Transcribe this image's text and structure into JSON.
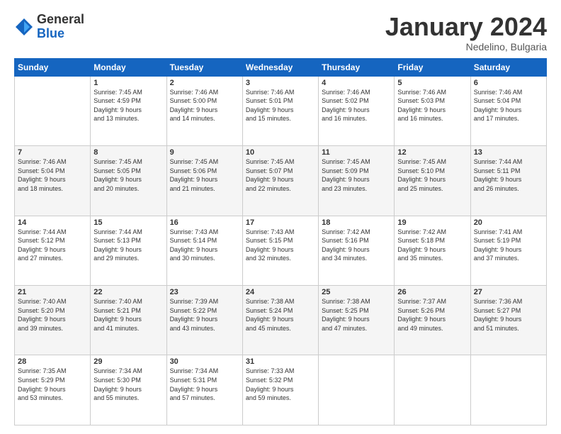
{
  "logo": {
    "general": "General",
    "blue": "Blue"
  },
  "title": "January 2024",
  "location": "Nedelino, Bulgaria",
  "days_of_week": [
    "Sunday",
    "Monday",
    "Tuesday",
    "Wednesday",
    "Thursday",
    "Friday",
    "Saturday"
  ],
  "weeks": [
    [
      {
        "day": "",
        "info": ""
      },
      {
        "day": "1",
        "info": "Sunrise: 7:45 AM\nSunset: 4:59 PM\nDaylight: 9 hours\nand 13 minutes."
      },
      {
        "day": "2",
        "info": "Sunrise: 7:46 AM\nSunset: 5:00 PM\nDaylight: 9 hours\nand 14 minutes."
      },
      {
        "day": "3",
        "info": "Sunrise: 7:46 AM\nSunset: 5:01 PM\nDaylight: 9 hours\nand 15 minutes."
      },
      {
        "day": "4",
        "info": "Sunrise: 7:46 AM\nSunset: 5:02 PM\nDaylight: 9 hours\nand 16 minutes."
      },
      {
        "day": "5",
        "info": "Sunrise: 7:46 AM\nSunset: 5:03 PM\nDaylight: 9 hours\nand 16 minutes."
      },
      {
        "day": "6",
        "info": "Sunrise: 7:46 AM\nSunset: 5:04 PM\nDaylight: 9 hours\nand 17 minutes."
      }
    ],
    [
      {
        "day": "7",
        "info": "Sunrise: 7:46 AM\nSunset: 5:04 PM\nDaylight: 9 hours\nand 18 minutes."
      },
      {
        "day": "8",
        "info": "Sunrise: 7:45 AM\nSunset: 5:05 PM\nDaylight: 9 hours\nand 20 minutes."
      },
      {
        "day": "9",
        "info": "Sunrise: 7:45 AM\nSunset: 5:06 PM\nDaylight: 9 hours\nand 21 minutes."
      },
      {
        "day": "10",
        "info": "Sunrise: 7:45 AM\nSunset: 5:07 PM\nDaylight: 9 hours\nand 22 minutes."
      },
      {
        "day": "11",
        "info": "Sunrise: 7:45 AM\nSunset: 5:09 PM\nDaylight: 9 hours\nand 23 minutes."
      },
      {
        "day": "12",
        "info": "Sunrise: 7:45 AM\nSunset: 5:10 PM\nDaylight: 9 hours\nand 25 minutes."
      },
      {
        "day": "13",
        "info": "Sunrise: 7:44 AM\nSunset: 5:11 PM\nDaylight: 9 hours\nand 26 minutes."
      }
    ],
    [
      {
        "day": "14",
        "info": "Sunrise: 7:44 AM\nSunset: 5:12 PM\nDaylight: 9 hours\nand 27 minutes."
      },
      {
        "day": "15",
        "info": "Sunrise: 7:44 AM\nSunset: 5:13 PM\nDaylight: 9 hours\nand 29 minutes."
      },
      {
        "day": "16",
        "info": "Sunrise: 7:43 AM\nSunset: 5:14 PM\nDaylight: 9 hours\nand 30 minutes."
      },
      {
        "day": "17",
        "info": "Sunrise: 7:43 AM\nSunset: 5:15 PM\nDaylight: 9 hours\nand 32 minutes."
      },
      {
        "day": "18",
        "info": "Sunrise: 7:42 AM\nSunset: 5:16 PM\nDaylight: 9 hours\nand 34 minutes."
      },
      {
        "day": "19",
        "info": "Sunrise: 7:42 AM\nSunset: 5:18 PM\nDaylight: 9 hours\nand 35 minutes."
      },
      {
        "day": "20",
        "info": "Sunrise: 7:41 AM\nSunset: 5:19 PM\nDaylight: 9 hours\nand 37 minutes."
      }
    ],
    [
      {
        "day": "21",
        "info": "Sunrise: 7:40 AM\nSunset: 5:20 PM\nDaylight: 9 hours\nand 39 minutes."
      },
      {
        "day": "22",
        "info": "Sunrise: 7:40 AM\nSunset: 5:21 PM\nDaylight: 9 hours\nand 41 minutes."
      },
      {
        "day": "23",
        "info": "Sunrise: 7:39 AM\nSunset: 5:22 PM\nDaylight: 9 hours\nand 43 minutes."
      },
      {
        "day": "24",
        "info": "Sunrise: 7:38 AM\nSunset: 5:24 PM\nDaylight: 9 hours\nand 45 minutes."
      },
      {
        "day": "25",
        "info": "Sunrise: 7:38 AM\nSunset: 5:25 PM\nDaylight: 9 hours\nand 47 minutes."
      },
      {
        "day": "26",
        "info": "Sunrise: 7:37 AM\nSunset: 5:26 PM\nDaylight: 9 hours\nand 49 minutes."
      },
      {
        "day": "27",
        "info": "Sunrise: 7:36 AM\nSunset: 5:27 PM\nDaylight: 9 hours\nand 51 minutes."
      }
    ],
    [
      {
        "day": "28",
        "info": "Sunrise: 7:35 AM\nSunset: 5:29 PM\nDaylight: 9 hours\nand 53 minutes."
      },
      {
        "day": "29",
        "info": "Sunrise: 7:34 AM\nSunset: 5:30 PM\nDaylight: 9 hours\nand 55 minutes."
      },
      {
        "day": "30",
        "info": "Sunrise: 7:34 AM\nSunset: 5:31 PM\nDaylight: 9 hours\nand 57 minutes."
      },
      {
        "day": "31",
        "info": "Sunrise: 7:33 AM\nSunset: 5:32 PM\nDaylight: 9 hours\nand 59 minutes."
      },
      {
        "day": "",
        "info": ""
      },
      {
        "day": "",
        "info": ""
      },
      {
        "day": "",
        "info": ""
      }
    ]
  ]
}
